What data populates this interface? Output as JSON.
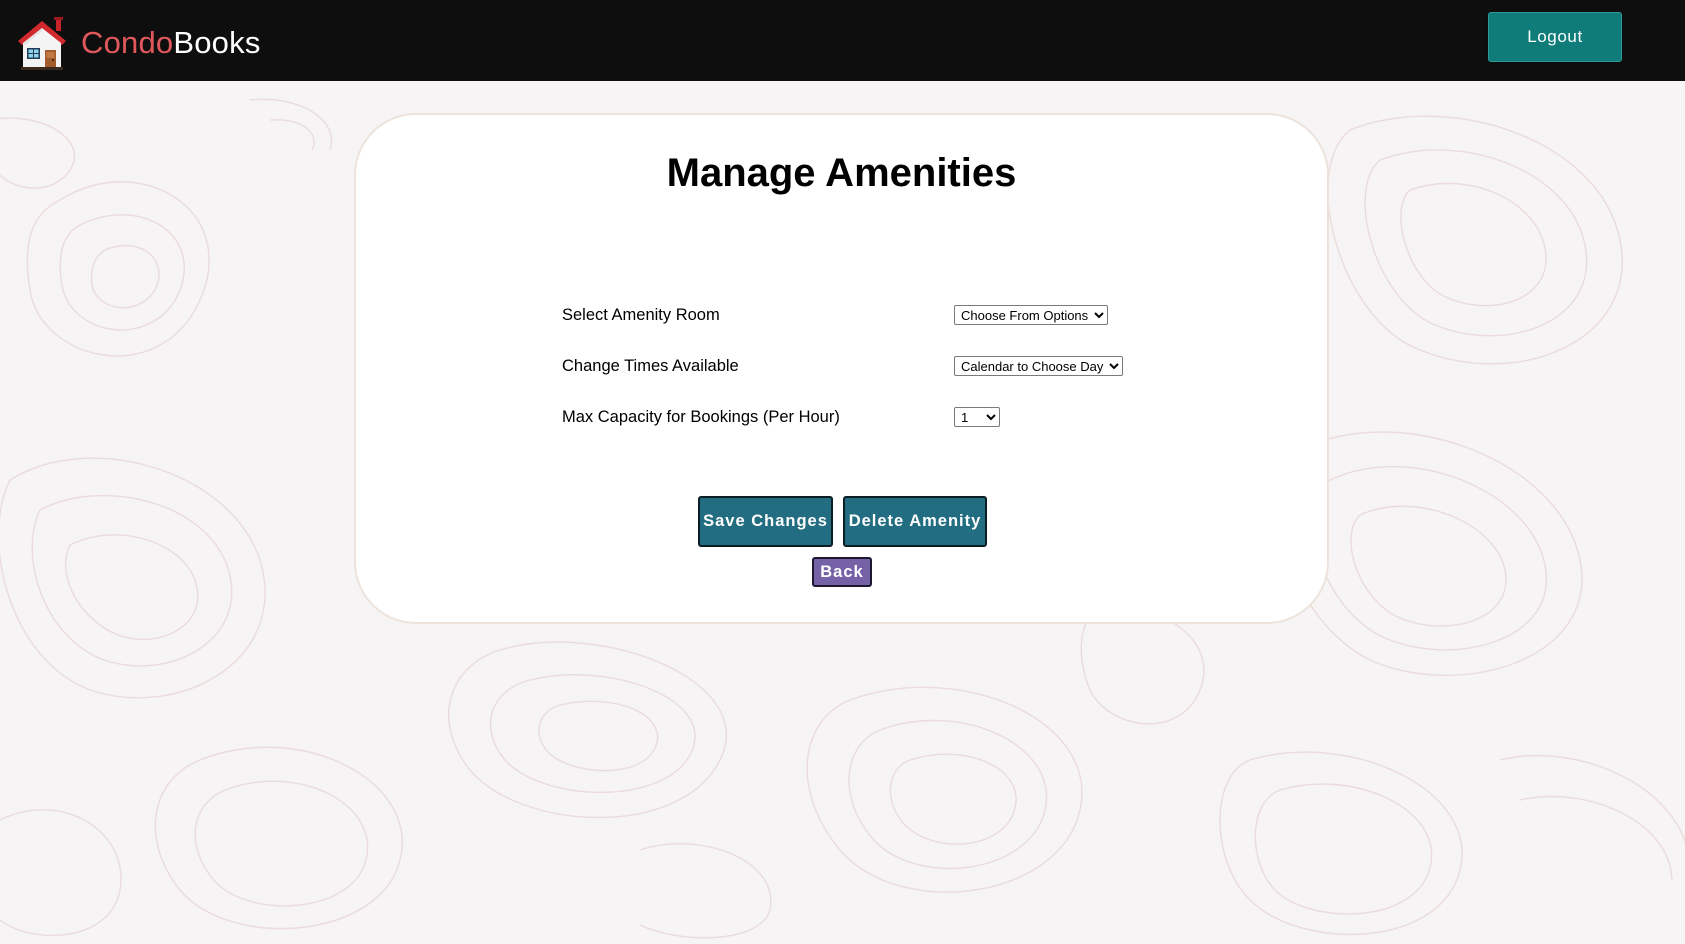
{
  "header": {
    "brand_part1": "Condo",
    "brand_part2": "Books",
    "logo_icon": "house-icon",
    "logout_label": "Logout"
  },
  "main": {
    "title": "Manage Amenities",
    "fields": [
      {
        "label": "Select Amenity Room",
        "selected": "Choose From Options"
      },
      {
        "label": "Change Times Available",
        "selected": "Calendar to Choose Day"
      },
      {
        "label": "Max Capacity for Bookings (Per Hour)",
        "selected": "1"
      }
    ],
    "save_label": "Save Changes",
    "delete_label": "Delete Amenity",
    "back_label": "Back"
  },
  "colors": {
    "navbar_bg": "#0e0e0e",
    "brand_accent": "#e0585b",
    "logout_bg": "#0f7c79",
    "action_bg": "#226d81",
    "back_bg": "#7561a6",
    "page_bg": "#f6f4f4"
  }
}
